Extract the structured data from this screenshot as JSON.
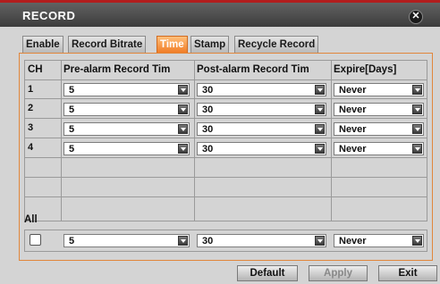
{
  "window": {
    "title": "RECORD"
  },
  "tabs": [
    {
      "label": "Enable"
    },
    {
      "label": "Record Bitrate"
    },
    {
      "label": "Time"
    },
    {
      "label": "Stamp"
    },
    {
      "label": "Recycle Record"
    }
  ],
  "active_tab": "Time",
  "table": {
    "headers": [
      "CH",
      "Pre-alarm Record Tim",
      "Post-alarm Record Tim",
      "Expire[Days]"
    ],
    "rows": [
      {
        "ch": "1",
        "pre": "5",
        "post": "30",
        "expire": "Never"
      },
      {
        "ch": "2",
        "pre": "5",
        "post": "30",
        "expire": "Never"
      },
      {
        "ch": "3",
        "pre": "5",
        "post": "30",
        "expire": "Never"
      },
      {
        "ch": "4",
        "pre": "5",
        "post": "30",
        "expire": "Never"
      }
    ]
  },
  "all": {
    "label": "All",
    "checked": false,
    "pre": "5",
    "post": "30",
    "expire": "Never"
  },
  "buttons": {
    "default": "Default",
    "apply": "Apply",
    "exit": "Exit"
  },
  "colors": {
    "accent": "#f07d27",
    "title_bar_stripe": "#b21d1d",
    "panel_border": "#e1873c"
  }
}
